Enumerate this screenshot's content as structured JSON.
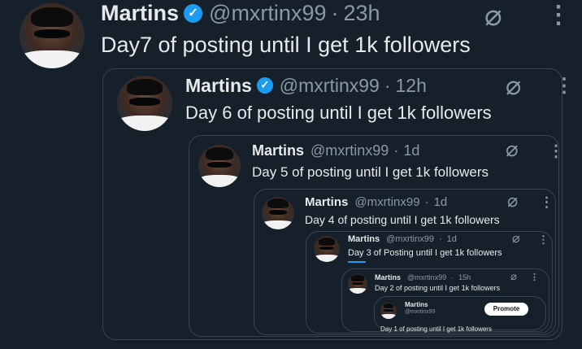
{
  "tweets": [
    {
      "name": "Martins",
      "handle": "@mxrtinx99",
      "dot": "·",
      "time": "23h",
      "text": "Day7 of posting until I get 1k followers"
    },
    {
      "name": "Martins",
      "handle": "@mxrtinx99",
      "dot": "·",
      "time": "12h",
      "text": "Day 6 of posting until I get 1k followers"
    },
    {
      "name": "Martins",
      "handle": "@mxrtinx99",
      "dot": "·",
      "time": "1d",
      "text": "Day 5 of posting until I get 1k followers"
    },
    {
      "name": "Martins",
      "handle": "@mxrtinx99",
      "dot": "·",
      "time": "1d",
      "text": "Day 4 of posting until I get 1k followers"
    },
    {
      "name": "Martins",
      "handle": "@mxrtinx99",
      "dot": "·",
      "time": "1d",
      "text": "Day 3 of Posting until I get 1k followers"
    },
    {
      "name": "Martins",
      "handle": "@mxrtinx99",
      "dot": "·",
      "time": "15h",
      "text": "Day 2 of posting until I get 1k followers"
    },
    {
      "name": "Martins",
      "handle": "@mxrtinx99",
      "text": "Day 1 of posting until I get 1k followers",
      "promote_label": "Promote"
    }
  ],
  "icons": {
    "grok": "⌀",
    "more": "⋮"
  },
  "colors": {
    "background": "#15202b",
    "text": "#e7e9ea",
    "muted": "#8b98a5",
    "accent": "#1d9bf0",
    "border": "#38444d"
  }
}
